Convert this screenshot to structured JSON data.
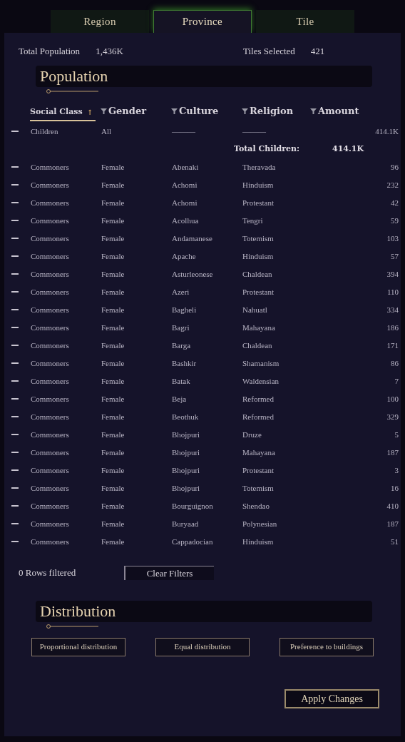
{
  "tabs": [
    {
      "label": "Region",
      "selected": false
    },
    {
      "label": "Province",
      "selected": true
    },
    {
      "label": "Tile",
      "selected": false
    }
  ],
  "stats": [
    {
      "label": "Total Population",
      "value": "1,436K"
    },
    {
      "label": "Tiles Selected",
      "value": "421"
    }
  ],
  "population": {
    "title": "Population",
    "columns": [
      {
        "label": "Social Class",
        "kind": "sort",
        "selected": true,
        "icon": "↑"
      },
      {
        "label": "Gender",
        "kind": "filter",
        "selected": false
      },
      {
        "label": "Culture",
        "kind": "filter",
        "selected": false
      },
      {
        "label": "Religion",
        "kind": "filter",
        "selected": false
      },
      {
        "label": "Amount",
        "kind": "filter",
        "selected": false
      }
    ],
    "rows": [
      {
        "kind": "row",
        "cells": [
          "Children",
          "All",
          "———",
          "———",
          "414.1K"
        ]
      },
      {
        "kind": "total",
        "label": "Total Children:",
        "value": "414.1K"
      },
      {
        "kind": "row",
        "cells": [
          "Commoners",
          "Female",
          "Abenaki",
          "Theravada",
          "96"
        ]
      },
      {
        "kind": "row",
        "cells": [
          "Commoners",
          "Female",
          "Achomi",
          "Hinduism",
          "232"
        ]
      },
      {
        "kind": "row",
        "cells": [
          "Commoners",
          "Female",
          "Achomi",
          "Protestant",
          "42"
        ]
      },
      {
        "kind": "row",
        "cells": [
          "Commoners",
          "Female",
          "Acolhua",
          "Tengri",
          "59"
        ]
      },
      {
        "kind": "row",
        "cells": [
          "Commoners",
          "Female",
          "Andamanese",
          "Totemism",
          "103"
        ]
      },
      {
        "kind": "row",
        "cells": [
          "Commoners",
          "Female",
          "Apache",
          "Hinduism",
          "57"
        ]
      },
      {
        "kind": "row",
        "cells": [
          "Commoners",
          "Female",
          "Asturleonese",
          "Chaldean",
          "394"
        ]
      },
      {
        "kind": "row",
        "cells": [
          "Commoners",
          "Female",
          "Azeri",
          "Protestant",
          "110"
        ]
      },
      {
        "kind": "row",
        "cells": [
          "Commoners",
          "Female",
          "Bagheli",
          "Nahuatl",
          "334"
        ]
      },
      {
        "kind": "row",
        "cells": [
          "Commoners",
          "Female",
          "Bagri",
          "Mahayana",
          "186"
        ]
      },
      {
        "kind": "row",
        "cells": [
          "Commoners",
          "Female",
          "Barga",
          "Chaldean",
          "171"
        ]
      },
      {
        "kind": "row",
        "cells": [
          "Commoners",
          "Female",
          "Bashkir",
          "Shamanism",
          "86"
        ]
      },
      {
        "kind": "row",
        "cells": [
          "Commoners",
          "Female",
          "Batak",
          "Waldensian",
          "7"
        ]
      },
      {
        "kind": "row",
        "cells": [
          "Commoners",
          "Female",
          "Beja",
          "Reformed",
          "100"
        ]
      },
      {
        "kind": "row",
        "cells": [
          "Commoners",
          "Female",
          "Beothuk",
          "Reformed",
          "329"
        ]
      },
      {
        "kind": "row",
        "cells": [
          "Commoners",
          "Female",
          "Bhojpuri",
          "Druze",
          "5"
        ]
      },
      {
        "kind": "row",
        "cells": [
          "Commoners",
          "Female",
          "Bhojpuri",
          "Mahayana",
          "187"
        ]
      },
      {
        "kind": "row",
        "cells": [
          "Commoners",
          "Female",
          "Bhojpuri",
          "Protestant",
          "3"
        ]
      },
      {
        "kind": "row",
        "cells": [
          "Commoners",
          "Female",
          "Bhojpuri",
          "Totemism",
          "16"
        ]
      },
      {
        "kind": "row",
        "cells": [
          "Commoners",
          "Female",
          "Bourguignon",
          "Shendao",
          "410"
        ]
      },
      {
        "kind": "row",
        "cells": [
          "Commoners",
          "Female",
          "Buryaad",
          "Polynesian",
          "187"
        ]
      },
      {
        "kind": "row",
        "cells": [
          "Commoners",
          "Female",
          "Cappadocian",
          "Hinduism",
          "51"
        ]
      }
    ],
    "rows_filtered": "0 Rows filtered",
    "clear_button": "Clear Filters"
  },
  "distribution": {
    "title": "Distribution",
    "buttons": [
      "Proportional distribution",
      "Equal distribution",
      "Preference to buildings"
    ]
  },
  "apply_button": "Apply Changes"
}
